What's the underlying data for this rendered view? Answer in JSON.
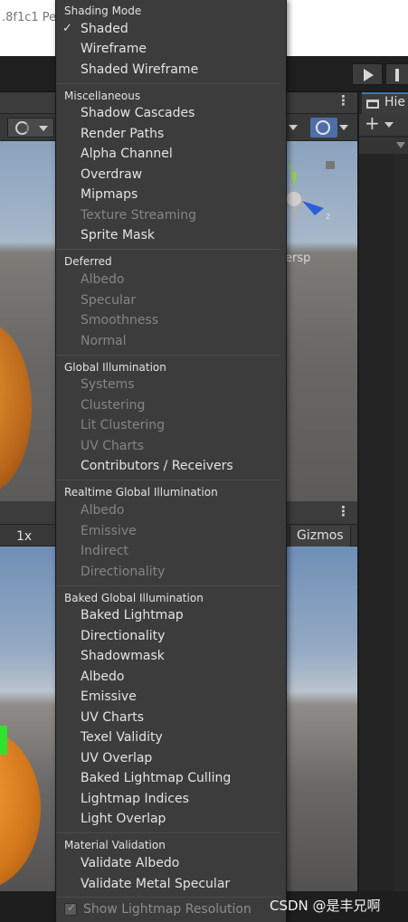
{
  "window": {
    "title": ".8f1c1 Pe"
  },
  "scene": {
    "persp_label": "ersp"
  },
  "hierarchy": {
    "tab_label": "Hie"
  },
  "game": {
    "scale_label": "1x",
    "gizmos_label": "Gizmos"
  },
  "menu": {
    "shading_mode": {
      "header": "Shading Mode",
      "items": [
        {
          "label": "Shaded",
          "checked": true
        },
        {
          "label": "Wireframe"
        },
        {
          "label": "Shaded Wireframe"
        }
      ]
    },
    "miscellaneous": {
      "header": "Miscellaneous",
      "items": [
        "Shadow Cascades",
        "Render Paths",
        "Alpha Channel",
        "Overdraw",
        "Mipmaps",
        "Texture Streaming",
        "Sprite Mask"
      ],
      "disabled": [
        "Texture Streaming"
      ]
    },
    "deferred": {
      "header": "Deferred",
      "items": [
        "Albedo",
        "Specular",
        "Smoothness",
        "Normal"
      ],
      "disabled": [
        "Albedo",
        "Specular",
        "Smoothness",
        "Normal"
      ]
    },
    "global_illumination": {
      "header": "Global Illumination",
      "items": [
        "Systems",
        "Clustering",
        "Lit Clustering",
        "UV Charts",
        "Contributors / Receivers"
      ],
      "disabled": [
        "Systems",
        "Clustering",
        "Lit Clustering",
        "UV Charts"
      ]
    },
    "realtime_gi": {
      "header": "Realtime Global Illumination",
      "items": [
        "Albedo",
        "Emissive",
        "Indirect",
        "Directionality"
      ],
      "disabled": [
        "Albedo",
        "Emissive",
        "Indirect",
        "Directionality"
      ]
    },
    "baked_gi": {
      "header": "Baked Global Illumination",
      "items": [
        "Baked Lightmap",
        "Directionality",
        "Shadowmask",
        "Albedo",
        "Emissive",
        "UV Charts",
        "Texel Validity",
        "UV Overlap",
        "Baked Lightmap Culling",
        "Lightmap Indices",
        "Light Overlap"
      ]
    },
    "material_validation": {
      "header": "Material Validation",
      "items": [
        "Validate Albedo",
        "Validate Metal Specular"
      ]
    },
    "footer": {
      "label": "Show Lightmap Resolution",
      "checked": true
    }
  },
  "watermark": "CSDN @是丰兄啊",
  "colors": {
    "menu_bg": "#3c3c3c",
    "enabled_text": "#e4e4e4",
    "disabled_text": "#858585",
    "accent": "#3a79bb"
  }
}
